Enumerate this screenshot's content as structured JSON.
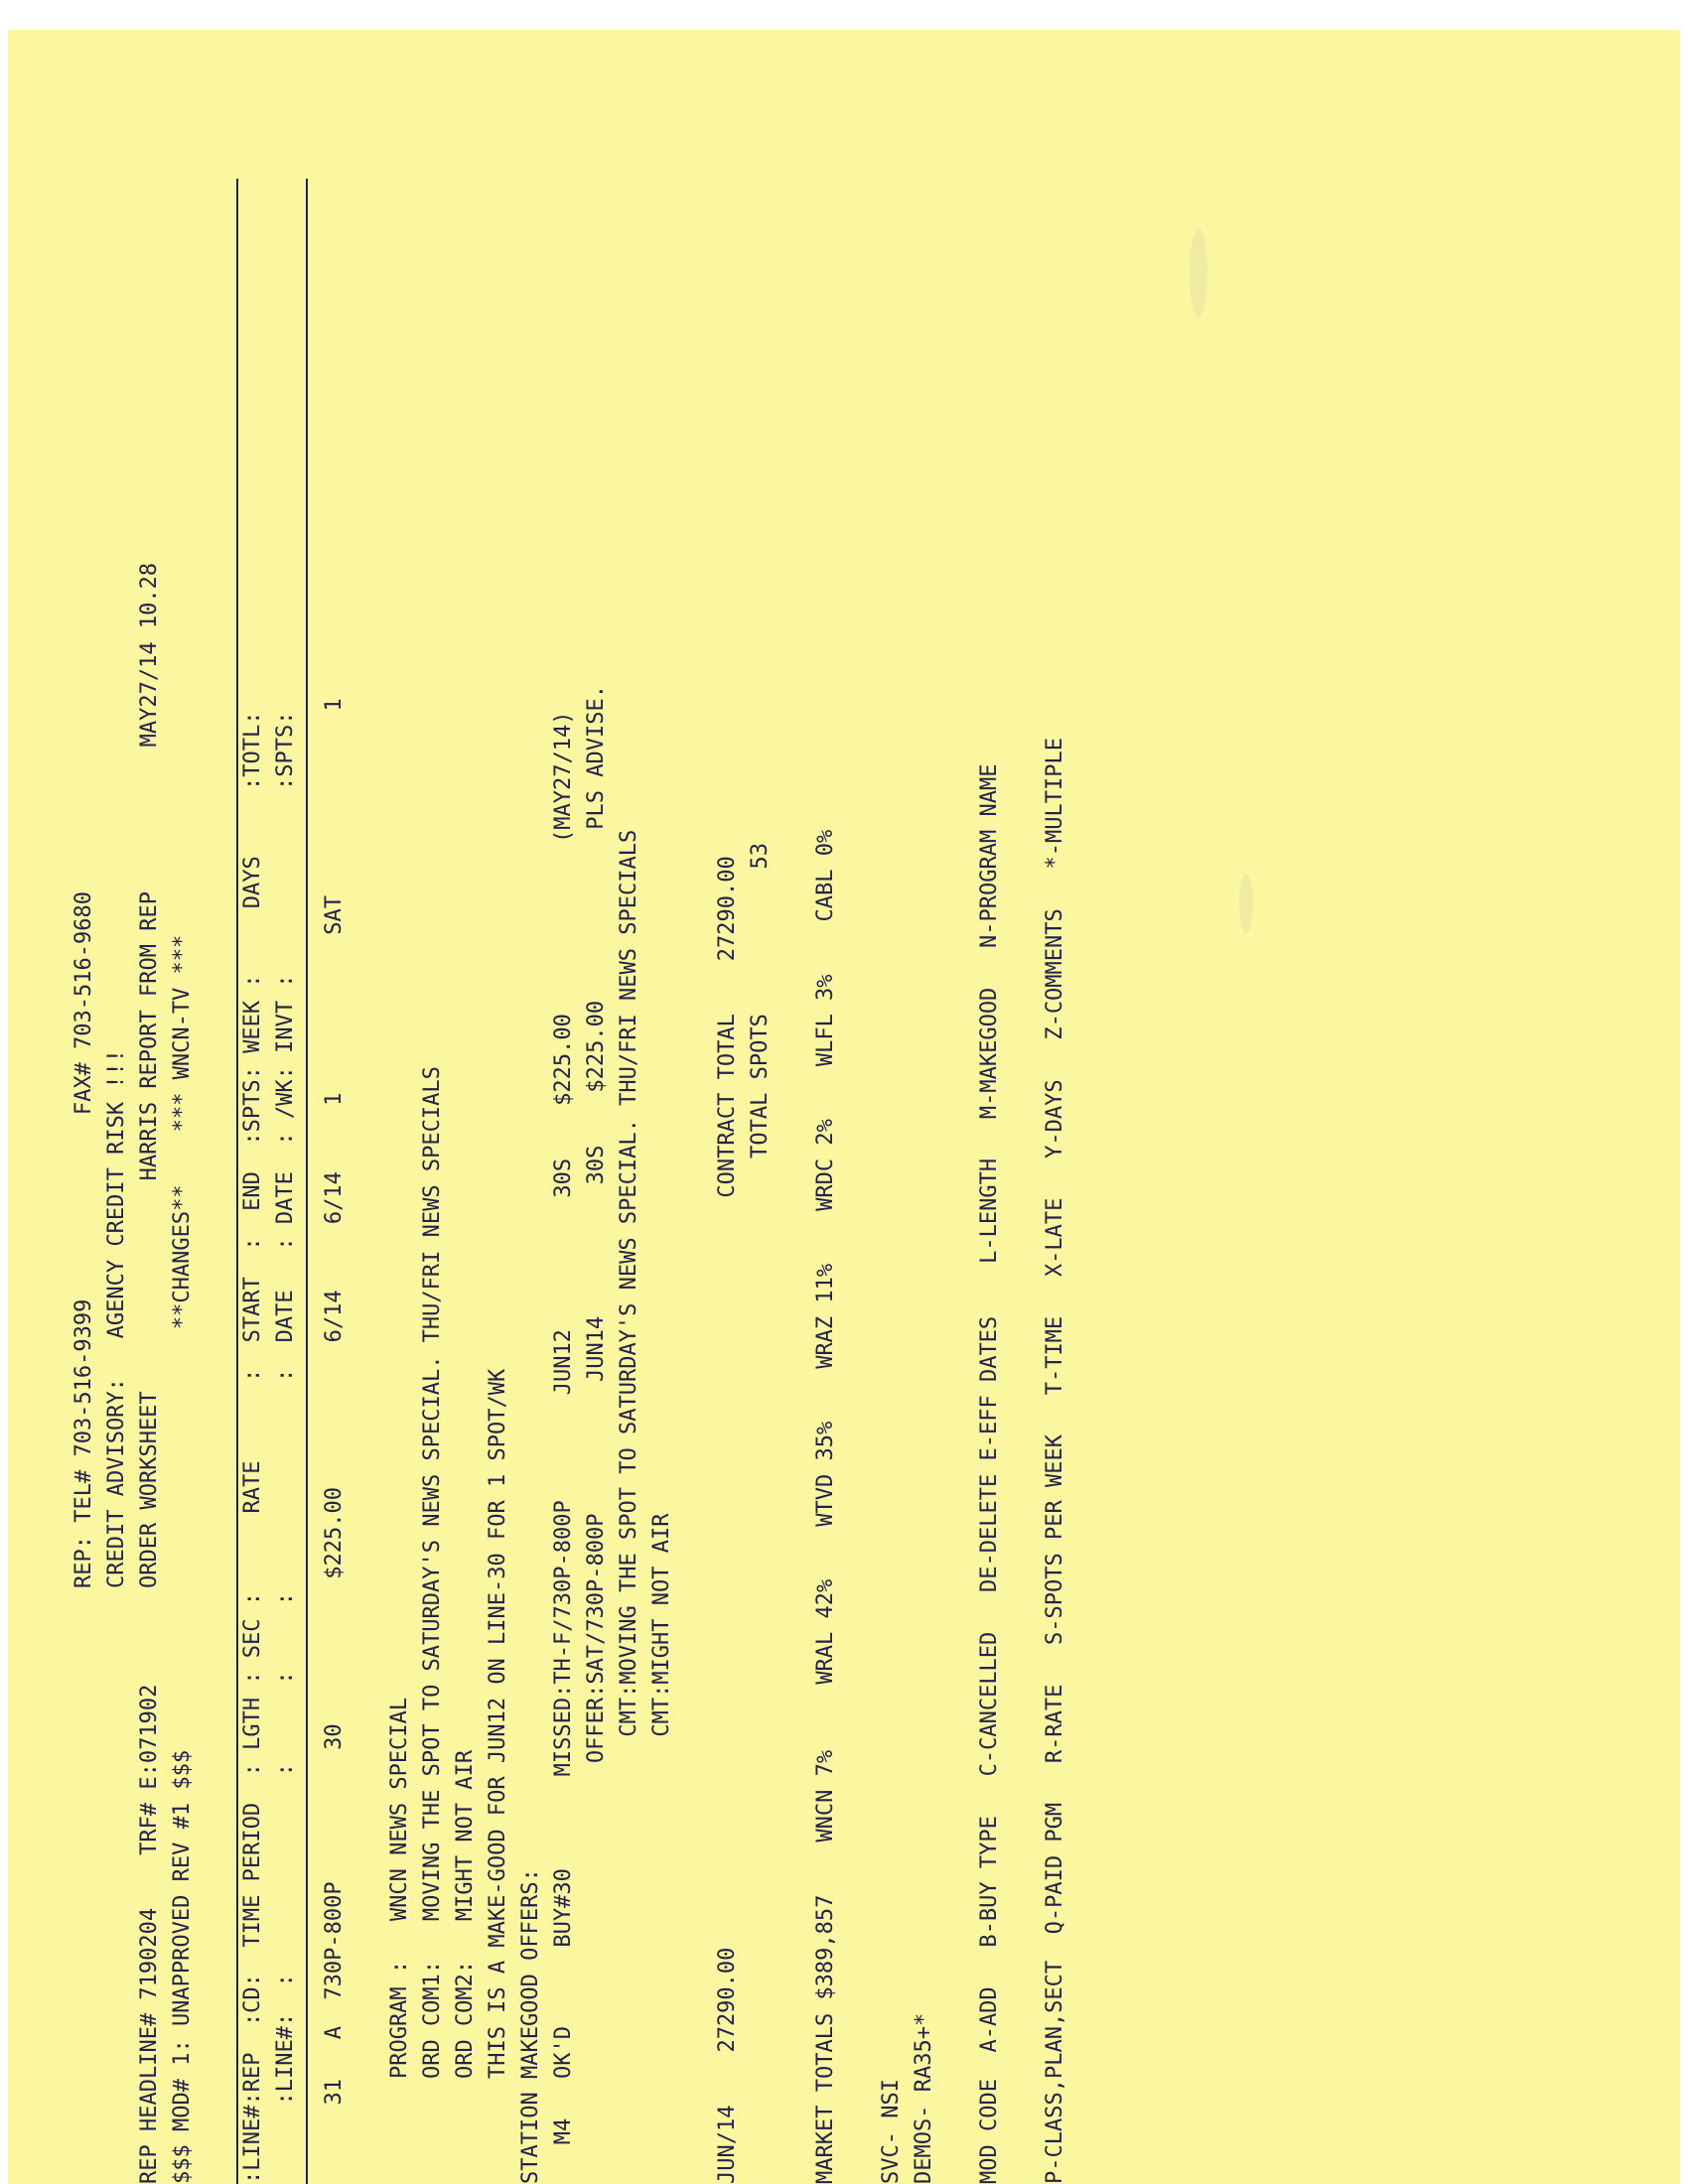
{
  "header": {
    "line1": "REP: TEL# 703-516-9399              FAX# 703-516-9680",
    "line2": "CREDIT ADVISORY:   AGENCY CREDIT RISK !!!",
    "line3": "ORDER WORKSHEET                HARRIS REPORT FROM REP           MAY27/14 10.28",
    "line4": "REP HEADLINE# 7190204    TRF# E:071902",
    "line5": "$$$ MOD# 1: UNAPPROVED REV #1 $$$                                **CHANGES**    *** WNCN-TV ***"
  },
  "columns": {
    "row1": ":LINE#:REP  :CD:  TIME PERIOD  : LGTH : SEC :      RATE      :  START  :  END  :SPTS: WEEK :     DAYS     :TOTL:",
    "row2": "      :LINE#:  :               :      :     :                :  DATE   : DATE  : /WK: INVT :              :SPTS:"
  },
  "order_line": {
    "text": "      31   A  730P-800P          30           $225.00           6/14     6/14     1            SAT              1"
  },
  "notes": {
    "program": "        PROGRAM :   WNCN NEWS SPECIAL",
    "com1": "        ORD COM1:   MOVING THE SPOT TO SATURDAY'S NEWS SPECIAL. THU/FRI NEWS SPECIALS",
    "com2": "        ORD COM2:   MIGHT NOT AIR",
    "makegood": "        THIS IS A MAKE-GOOD FOR JUN12 ON LINE-30 FOR 1 SPOT/WK"
  },
  "makegood": {
    "heading": "STATION MAKEGOOD OFFERS:",
    "missed": "   M4   OK'D      BUY#30       MISSED:TH-F/730P-800P        JUN12          30S    $225.00             (MAY27/14)",
    "offer": "                                OFFER:SAT/730P-800P          JUN14          30S    $225.00             PLS ADVISE.",
    "cmt1": "                                  CMT:MOVING THE SPOT TO SATURDAY'S NEWS SPECIAL. THU/FRI NEWS SPECIALS",
    "cmt2": "                                  CMT:MIGHT NOT AIR"
  },
  "totals": {
    "month_line": "JUN/14    27290.00                                                         CONTRACT TOTAL    27290.00",
    "spots_line": "                                                                              TOTAL SPOTS           53"
  },
  "market": {
    "line": "MARKET TOTALS $389,857    WNCN 7%     WRAL 42%    WTVD 35%    WRAZ 11%    WRDC 2%    WLFL 3%    CABL 0%",
    "svc": "SVC- NSI",
    "demos": "DEMOS- RA35+*"
  },
  "legend": {
    "line1": "MOD CODE  A-ADD   B-BUY TYPE   C-CANCELLED   DE-DELETE E-EFF DATES    L-LENGTH   M-MAKEGOOD   N-PROGRAM NAME",
    "line2": "P-CLASS,PLAN,SECT  Q-PAID PGM   R-RATE   S-SPOTS PER WEEK   T-TIME   X-LATE   Y-DAYS   Z-COMMENTS   *-MULTIPLE"
  }
}
